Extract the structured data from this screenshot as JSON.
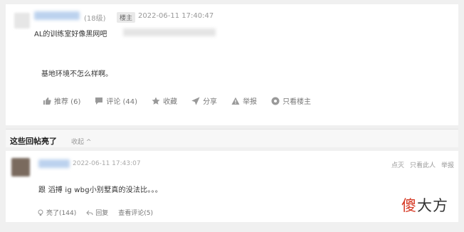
{
  "post": {
    "level": "(18级)",
    "badge": "楼主",
    "time": "2022-06-11 17:40:47",
    "title": "AL的训练室好像黑网吧",
    "content": "基地环境不怎么样啊。",
    "actions": [
      {
        "icon": "thumbs-up-icon",
        "label": "推荐 (6)"
      },
      {
        "icon": "comment-icon",
        "label": "评论 (44)"
      },
      {
        "icon": "star-icon",
        "label": "收藏"
      },
      {
        "icon": "share-icon",
        "label": "分享"
      },
      {
        "icon": "warning-icon",
        "label": "举报"
      },
      {
        "icon": "eye-icon",
        "label": "只看楼主"
      }
    ]
  },
  "hot_section": {
    "title": "这些回帖亮了",
    "collapse": "收起 ^"
  },
  "reply": {
    "time": "2022-06-11 17:43:07",
    "right_links": [
      "点灭",
      "只看此人",
      "举报"
    ],
    "content": "跟 滔搏 ig wbg小别墅真的没法比。。。",
    "actions": [
      {
        "icon": "light-bulb-icon",
        "label": "亮了(144)"
      },
      {
        "icon": "reply-icon",
        "label": "回复"
      },
      {
        "icon": "view-comments-icon",
        "label": "查看评论(5)"
      }
    ]
  },
  "watermark": {
    "first_char": "傻",
    "rest": "大方"
  }
}
